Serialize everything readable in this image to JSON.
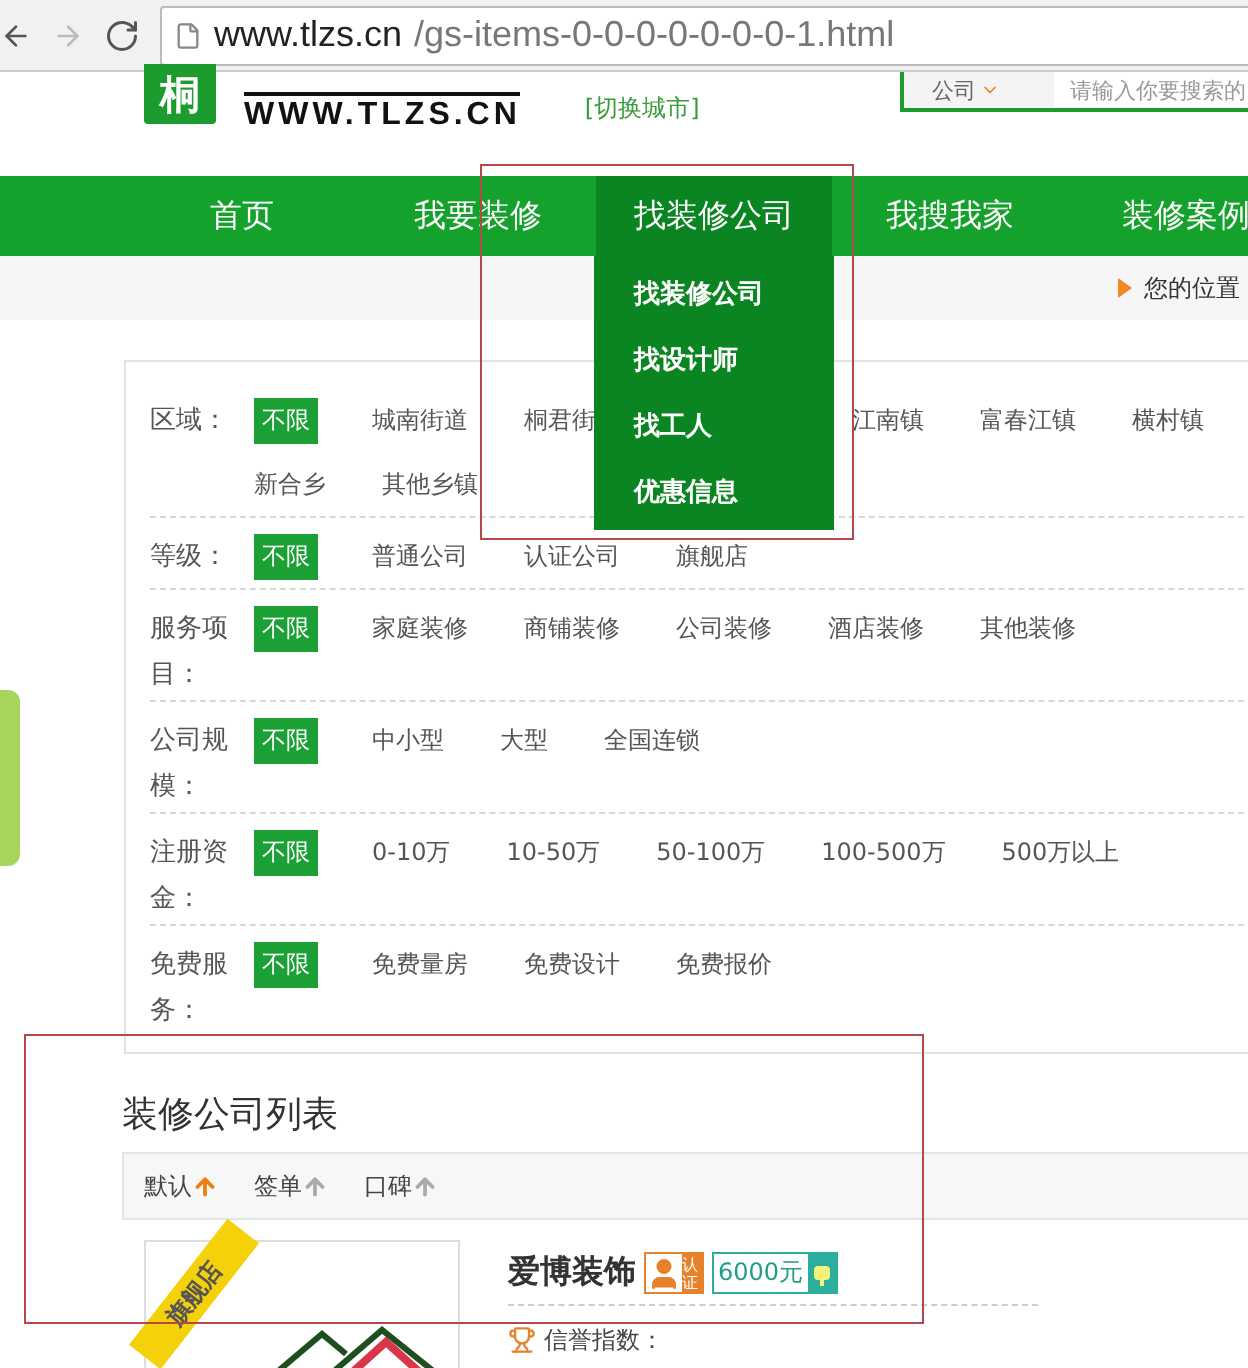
{
  "browser": {
    "url_host": "www.tlzs.cn",
    "url_path": "/gs-items-0-0-0-0-0-0-0-1.html"
  },
  "header": {
    "logo_glyph": "桐",
    "logo_domain": "WWW.TLZS.CN",
    "city_switch": "[切换城市]",
    "search": {
      "category": "公司",
      "placeholder": "请输入你要搜索的"
    }
  },
  "nav": {
    "items": [
      {
        "label": "首页",
        "selected": false
      },
      {
        "label": "我要装修",
        "selected": false
      },
      {
        "label": "找装修公司",
        "selected": true
      },
      {
        "label": "我搜我家",
        "selected": false
      },
      {
        "label": "装修案例",
        "selected": false
      }
    ],
    "dropdown": [
      "找装修公司",
      "找设计师",
      "找工人",
      "优惠信息"
    ]
  },
  "breadcrumb": {
    "label": "您的位置"
  },
  "filters": [
    {
      "label": "区域：",
      "options": [
        {
          "text": "不限",
          "selected": true
        },
        {
          "text": "城南街道",
          "selected": false
        },
        {
          "text": "桐君街",
          "selected": false
        },
        {
          "text": "江南镇",
          "selected": false
        },
        {
          "text": "富春江镇",
          "selected": false
        },
        {
          "text": "横村镇",
          "selected": false
        },
        {
          "text": "新合乡",
          "selected": false
        },
        {
          "text": "其他乡镇",
          "selected": false
        }
      ]
    },
    {
      "label": "等级：",
      "options": [
        {
          "text": "不限",
          "selected": true
        },
        {
          "text": "普通公司",
          "selected": false
        },
        {
          "text": "认证公司",
          "selected": false
        },
        {
          "text": "旗舰店",
          "selected": false
        }
      ]
    },
    {
      "label": "服务项目：",
      "options": [
        {
          "text": "不限",
          "selected": true
        },
        {
          "text": "家庭装修",
          "selected": false
        },
        {
          "text": "商铺装修",
          "selected": false
        },
        {
          "text": "公司装修",
          "selected": false
        },
        {
          "text": "酒店装修",
          "selected": false
        },
        {
          "text": "其他装修",
          "selected": false
        }
      ]
    },
    {
      "label": "公司规模：",
      "options": [
        {
          "text": "不限",
          "selected": true
        },
        {
          "text": "中小型",
          "selected": false
        },
        {
          "text": "大型",
          "selected": false
        },
        {
          "text": "全国连锁",
          "selected": false
        }
      ]
    },
    {
      "label": "注册资金：",
      "options": [
        {
          "text": "不限",
          "selected": true
        },
        {
          "text": "0-10万",
          "selected": false
        },
        {
          "text": "10-50万",
          "selected": false
        },
        {
          "text": "50-100万",
          "selected": false
        },
        {
          "text": "100-500万",
          "selected": false
        },
        {
          "text": "500万以上",
          "selected": false
        }
      ]
    },
    {
      "label": "免费服务：",
      "options": [
        {
          "text": "不限",
          "selected": true
        },
        {
          "text": "免费量房",
          "selected": false
        },
        {
          "text": "免费设计",
          "selected": false
        },
        {
          "text": "免费报价",
          "selected": false
        }
      ]
    }
  ],
  "list": {
    "title": "装修公司列表",
    "sort": [
      {
        "label": "默认",
        "selected": true
      },
      {
        "label": "签单",
        "selected": false
      },
      {
        "label": "口碑",
        "selected": false
      }
    ],
    "company": {
      "ribbon": "旗舰店",
      "name": "爱博装饰",
      "cert": "认证",
      "price": "6000元",
      "credit_label": "信誉指数："
    }
  }
}
